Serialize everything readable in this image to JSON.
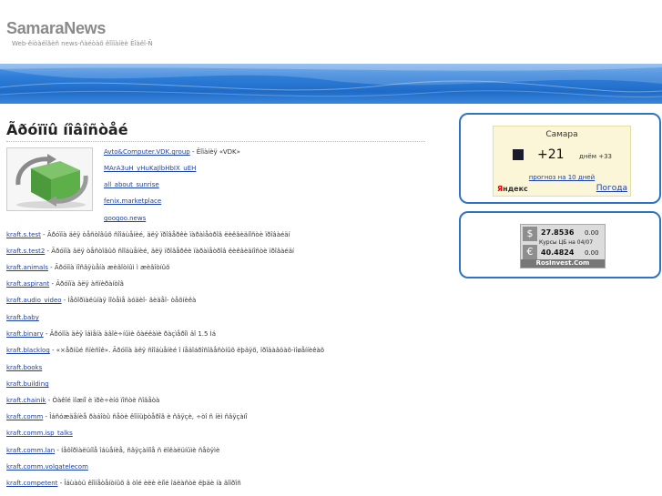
{
  "site": {
    "title": "SamaraNews",
    "tagline": "Web-êiòàëîãèñ news-ñàéòàõ êîïïàíèè Êîàëî-Ñ"
  },
  "main": {
    "heading": "Ãðóïïû íîâîñòåé",
    "top_links": [
      {
        "link": "Avto&Computer.VDK.group",
        "desc": " - Êîïàíèÿ «VDK»"
      },
      {
        "link": "MArA3uH_yHuKaJlbHbIX_uEH",
        "desc": ""
      },
      {
        "link": "all_about_sunrise",
        "desc": ""
      },
      {
        "link": "fenix.marketplace",
        "desc": ""
      },
      {
        "link": "googoo.news",
        "desc": ""
      }
    ],
    "groups": [
      {
        "link": "kraft.s.test",
        "desc": " - Ãðóïïà äëÿ òåñòîâûõ ñîîáùåíèé, äëÿ ïðîâåðêè ïàðàìåòðîâ ëèêâèäíîñòè ïðîâàéäí"
      },
      {
        "link": "kraft.s.test2",
        "desc": " - Ãðóïïà äëÿ òåñòîâûõ ñîîáùåíèé, äëÿ ïðîâåðêè ïàðàìåòðîâ ëèêâèäíîñòè ïðîâàéäí"
      },
      {
        "link": "kraft.animals",
        "desc": " - Ãðóïïà ïîñâÿùåíà æèâîòíûì ì æèâîòíûõ"
      },
      {
        "link": "kraft.aspirant",
        "desc": " - Ãðóïïà äëÿ àñïèðàíòîâ"
      },
      {
        "link": "kraft.audio_video",
        "desc": " - Íåôîðìàëüíàÿ ïîòåìå àóäèî- âèäåî- òåõíèêà"
      },
      {
        "link": "kraft.baby",
        "desc": ""
      },
      {
        "link": "kraft.binary",
        "desc": " - Ãðóïïà äëÿ îáìåíà äâîè÷íûìè ôàéëàìè ðàçìåðîì äî 1.5 Ìá"
      },
      {
        "link": "kraft.blacklog",
        "desc": " - «×åðíûé ñïèñîê». Ãðóïïà äëÿ ñîîáùåíèé î íåäîáðîñîâåñòíûõ ëþäÿõ, ïðîäàâöàõ-ìîøåííèêàõ"
      },
      {
        "link": "kraft.books",
        "desc": ""
      },
      {
        "link": "kraft.building",
        "desc": ""
      },
      {
        "link": "kraft.chainik",
        "desc": " - Òàêîé ìîæíî è ïðè÷èíó ïîñòè ñîâåòà"
      },
      {
        "link": "kraft.comm",
        "desc": " - Îáñóæäåíèå ðàáîòû ñåòè êîìïüþòåðîâ è ñâÿçè, ÷òî ñ íèì ñâÿçàíî"
      },
      {
        "link": "kraft.comm.isp_talks",
        "desc": ""
      },
      {
        "link": "kraft.comm.lan",
        "desc": " - Íåôîðìàëüíîå îáùåíèå, ñâÿçàííîå ñ ëîêàëüíûìè ñåòÿìè"
      },
      {
        "link": "kraft.comm.volgatelecom",
        "desc": ""
      },
      {
        "link": "kraft.competent",
        "desc": " - Îáùàòü êîìïåòåíòíûõ â òîé èëè èíîé îáëàñòè ëþäè íà âîïðîñ"
      }
    ]
  },
  "weather_widget": {
    "city": "Самара",
    "temp": "+21",
    "days": "днём +33",
    "forecast": "прогноз на 10 дней",
    "brand_red": "Я",
    "brand_rest": "ндекс",
    "city_link": "Погода"
  },
  "rates_widget": {
    "usd_symbol": "$",
    "usd_value": "27.8536",
    "usd_change": "0.00",
    "mid_label": "Курсы ЦБ на",
    "mid_date": "04/07",
    "eur_symbol": "€",
    "eur_value": "40.4824",
    "eur_change": "0.00",
    "brand": "RosInvest.Com"
  }
}
